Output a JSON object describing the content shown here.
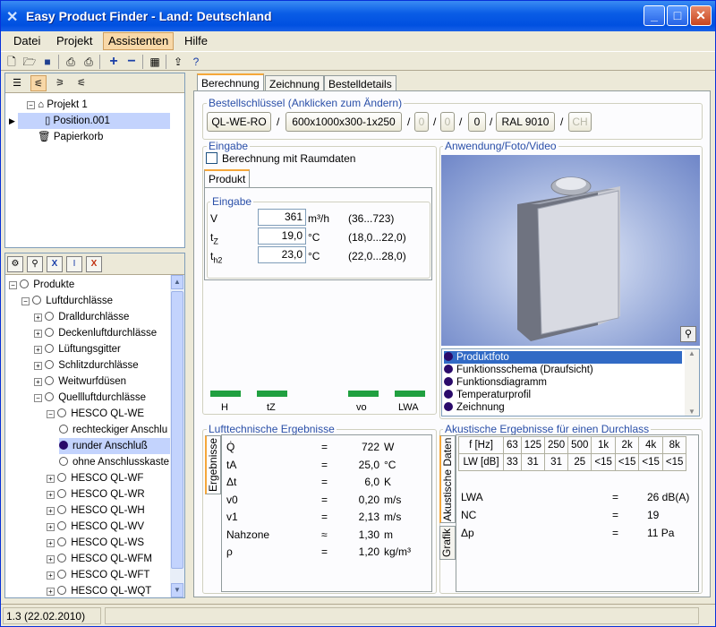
{
  "window": {
    "title": "Easy Product Finder - Land: Deutschland",
    "min": "_",
    "max": "□",
    "close": "✕"
  },
  "menu": [
    "Datei",
    "Projekt",
    "Assistenten",
    "Hilfe"
  ],
  "project_tree": {
    "items": [
      "Projekt 1",
      "Position.001",
      "Papierkorb"
    ]
  },
  "product_tree": {
    "items": [
      "Produkte",
      "Luftdurchlässe",
      "Dralldurchlässe",
      "Deckenluftdurchlässe",
      "Lüftungsgitter",
      "Schlitzdurchlässe",
      "Weitwurfdüsen",
      "Quellluftdurchlässe",
      "HESCO QL-WE",
      "rechteckiger Anschlu",
      "runder Anschluß",
      "ohne Anschlusskaste",
      "HESCO QL-WF",
      "HESCO QL-WR",
      "HESCO QL-WH",
      "HESCO QL-WV",
      "HESCO QL-WS",
      "HESCO QL-WFM",
      "HESCO QL-WFT",
      "HESCO QL-WQT"
    ]
  },
  "tabs": [
    "Berechnung",
    "Zeichnung",
    "Bestelldetails"
  ],
  "order_key": {
    "label": "Bestellschlüssel (Anklicken zum Ändern)",
    "parts": [
      "QL-WE-RO",
      "600x1000x300-1x250",
      "0",
      "0",
      "0",
      "RAL 9010",
      "CH"
    ],
    "sep": "/"
  },
  "input": {
    "group": "Eingabe",
    "checkbox": "Berechnung mit Raumdaten",
    "subtab": "Produkt",
    "subgroup": "Eingabe",
    "rows": [
      {
        "label": "V",
        "value": "361",
        "unit": "m³/h",
        "range": "(36...723)"
      },
      {
        "label": "t",
        "sub": "Z",
        "value": "19,0",
        "unit": "°C",
        "range": "(18,0...22,0)"
      },
      {
        "label": "t",
        "sub": "h2",
        "value": "23,0",
        "unit": "°C",
        "range": "(22,0...28,0)"
      }
    ]
  },
  "indicators": [
    "H",
    "tZ",
    "vo",
    "LWA"
  ],
  "media": {
    "group": "Anwendung/Foto/Video",
    "list": [
      "Produktfoto",
      "Funktionsschema (Draufsicht)",
      "Funktionsdiagramm",
      "Temperaturprofil",
      "Zeichnung"
    ]
  },
  "air_results": {
    "group": "Lufttechnische Ergebnisse",
    "vtab": "Ergebnisse",
    "rows": [
      {
        "sym": "Q̇",
        "eq": "=",
        "val": "722",
        "unit": "W"
      },
      {
        "sym": "tA",
        "eq": "=",
        "val": "25,0",
        "unit": "°C"
      },
      {
        "sym": "Δt",
        "eq": "=",
        "val": "6,0",
        "unit": "K"
      },
      {
        "sym": "v0",
        "eq": "=",
        "val": "0,20",
        "unit": "m/s"
      },
      {
        "sym": "v1",
        "eq": "=",
        "val": "2,13",
        "unit": "m/s"
      },
      {
        "sym": "Nahzone",
        "eq": "≈",
        "val": "1,30",
        "unit": "m"
      },
      {
        "sym": "ρ",
        "eq": "=",
        "val": "1,20",
        "unit": "kg/m³"
      }
    ]
  },
  "acoustic": {
    "group": "Akustische Ergebnisse für einen Durchlass",
    "vtabs": [
      "Akustische Daten",
      "Grafik"
    ],
    "head": [
      "f [Hz]",
      "63",
      "125",
      "250",
      "500",
      "1k",
      "2k",
      "4k",
      "8k"
    ],
    "row": [
      "LW [dB]",
      "33",
      "31",
      "31",
      "25",
      "<15",
      "<15",
      "<15",
      "<15"
    ],
    "results": [
      {
        "sym": "LWA",
        "eq": "=",
        "val": "26 dB(A)"
      },
      {
        "sym": "NC",
        "eq": "=",
        "val": "19"
      },
      {
        "sym": "Δp",
        "eq": "=",
        "val": "11 Pa"
      }
    ]
  },
  "status": {
    "version": "1.3 (22.02.2010)"
  }
}
